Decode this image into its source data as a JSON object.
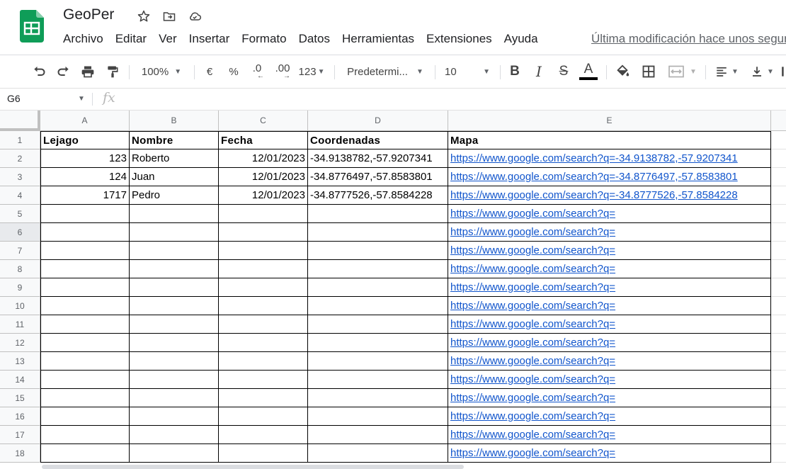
{
  "app": {
    "doc_title": "GeoPer",
    "last_edit": "Última modificación hace unos segundos"
  },
  "menu": [
    "Archivo",
    "Editar",
    "Ver",
    "Insertar",
    "Formato",
    "Datos",
    "Herramientas",
    "Extensiones",
    "Ayuda"
  ],
  "toolbar": {
    "zoom": "100%",
    "currency": "€",
    "percent": "%",
    "decrease_decimals": ".0",
    "increase_decimals": ".00",
    "more_formats": "123",
    "font": "Predetermi...",
    "font_size": "10",
    "bold": "B",
    "italic": "I",
    "strike": "S",
    "text_color": "A",
    "text_color_swatch": "#000000"
  },
  "formula_bar": {
    "cell_ref": "G6",
    "fx": "fx",
    "value": ""
  },
  "sheet": {
    "columns": [
      "A",
      "B",
      "C",
      "D",
      "E"
    ],
    "header": [
      "Lejago",
      "Nombre",
      "Fecha",
      "Coordenadas",
      "Mapa"
    ],
    "rows": [
      [
        "123",
        "Roberto",
        "12/01/2023",
        "-34.9138782,-57.9207341",
        "https://www.google.com/search?q=-34.9138782,-57.9207341"
      ],
      [
        "124",
        "Juan",
        "12/01/2023",
        "-34.8776497,-57.8583801",
        "https://www.google.com/search?q=-34.8776497,-57.8583801"
      ],
      [
        "1717",
        "Pedro",
        "12/01/2023",
        "-34.8777526,-57.8584228",
        "https://www.google.com/search?q=-34.8777526,-57.8584228"
      ],
      [
        "",
        "",
        "",
        "",
        "https://www.google.com/search?q="
      ],
      [
        "",
        "",
        "",
        "",
        "https://www.google.com/search?q="
      ],
      [
        "",
        "",
        "",
        "",
        "https://www.google.com/search?q="
      ],
      [
        "",
        "",
        "",
        "",
        "https://www.google.com/search?q="
      ],
      [
        "",
        "",
        "",
        "",
        "https://www.google.com/search?q="
      ],
      [
        "",
        "",
        "",
        "",
        "https://www.google.com/search?q="
      ],
      [
        "",
        "",
        "",
        "",
        "https://www.google.com/search?q="
      ],
      [
        "",
        "",
        "",
        "",
        "https://www.google.com/search?q="
      ],
      [
        "",
        "",
        "",
        "",
        "https://www.google.com/search?q="
      ],
      [
        "",
        "",
        "",
        "",
        "https://www.google.com/search?q="
      ],
      [
        "",
        "",
        "",
        "",
        "https://www.google.com/search?q="
      ],
      [
        "",
        "",
        "",
        "",
        "https://www.google.com/search?q="
      ],
      [
        "",
        "",
        "",
        "",
        "https://www.google.com/search?q="
      ],
      [
        "",
        "",
        "",
        "",
        "https://www.google.com/search?q="
      ]
    ],
    "row_numbers": [
      "1",
      "2",
      "3",
      "4",
      "5",
      "6",
      "7",
      "8",
      "9",
      "10",
      "11",
      "12",
      "13",
      "14",
      "15",
      "16",
      "17",
      "18"
    ],
    "active_row": "6",
    "link_color": "#1155cc"
  },
  "colors": {
    "sheets_green": "#0f9d58",
    "header_bg": "#f8f9fa"
  }
}
